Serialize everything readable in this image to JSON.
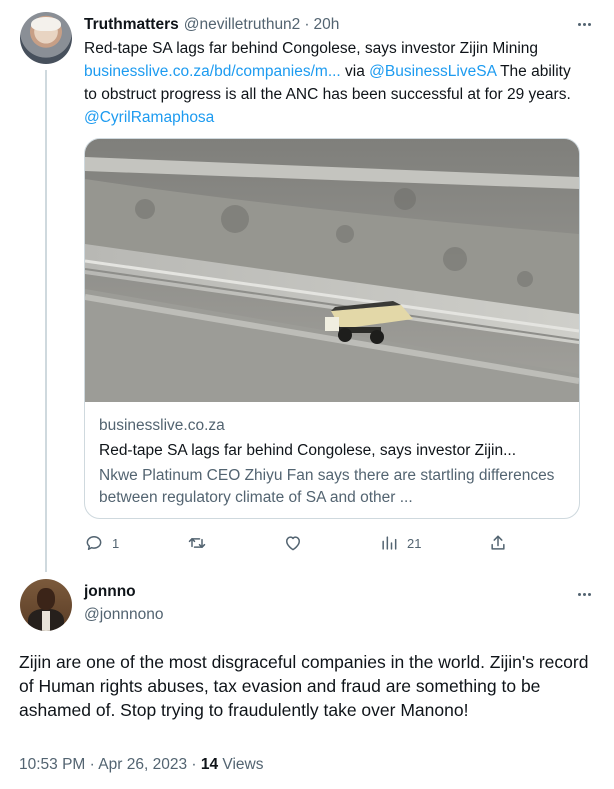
{
  "tweet1": {
    "display_name": "Truthmatters",
    "handle": "@nevilletruthun2",
    "separator": "·",
    "time": "20h",
    "text_a": "Red-tape SA lags far behind Congolese, says investor Zijin Mining ",
    "link_url": "businesslive.co.za/bd/companies/m...",
    "text_b": " via ",
    "mention_1": "@BusinessLiveSA",
    "text_c": " The ability to obstruct progress is all the ANC has been successful at for 29 years. ",
    "mention_2": "@CyrilRamaphosa",
    "card": {
      "image_alt": "open-pit mine with haul truck",
      "domain": "businesslive.co.za",
      "title": "Red-tape SA lags far behind Congolese, says investor Zijin...",
      "description": "Nkwe Platinum CEO Zhiyu Fan says there are startling differences between regulatory climate of SA and other ..."
    },
    "actions": {
      "reply_count": "1",
      "retweet_count": "",
      "like_count": "",
      "views_count": "21"
    },
    "icons": [
      "reply-icon",
      "retweet-icon",
      "like-icon",
      "views-icon",
      "share-icon"
    ]
  },
  "tweet2": {
    "display_name": "jonnno",
    "handle": "@jonnnono",
    "text": "Zijin are one of the most disgraceful companies in the world. Zijin's record of Human rights abuses, tax evasion and fraud are something to be ashamed of. Stop trying to fraudulently take over Manono!",
    "time": "10:53 PM",
    "date": "Apr 26, 2023",
    "separator": "·",
    "views_count": "14",
    "views_label": "Views"
  },
  "colors": {
    "link": "#1d9bf0",
    "text": "#0f1419",
    "muted": "#536471",
    "border": "#cfd9de"
  }
}
